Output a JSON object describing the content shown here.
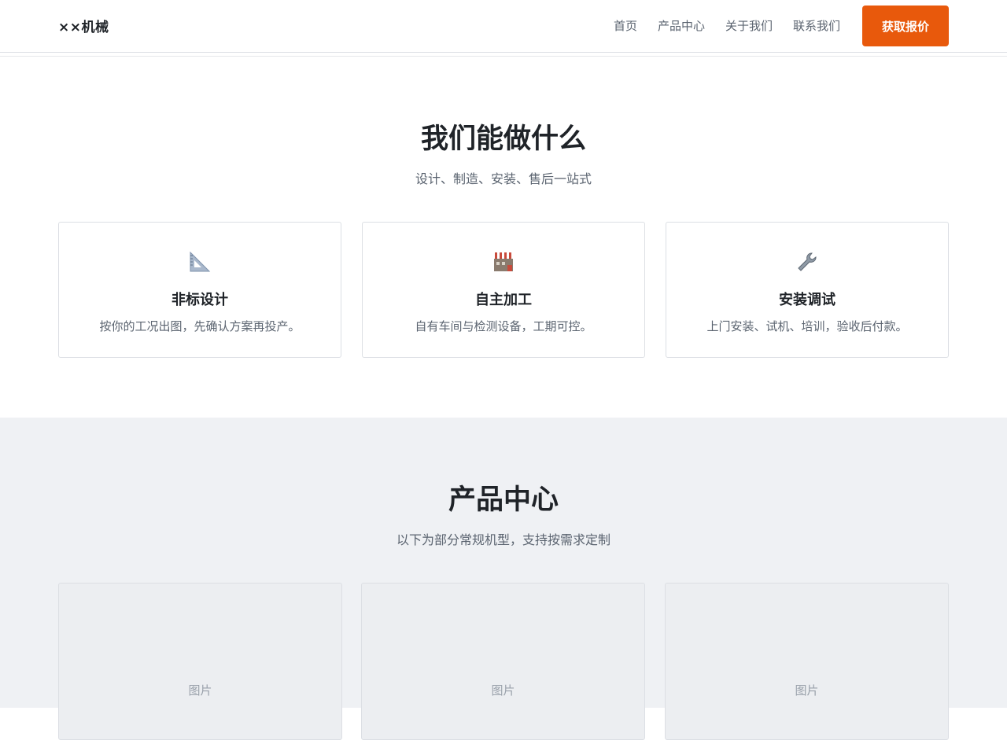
{
  "header": {
    "logo": "××机械",
    "nav": [
      "首页",
      "产品中心",
      "关于我们",
      "联系我们"
    ],
    "cta_label": "获取报价",
    "accent_color": "#e8590c"
  },
  "services": {
    "title": "我们能做什么",
    "subtitle": "设计、制造、安装、售后一站式",
    "cards": [
      {
        "icon": "triangle-ruler-icon",
        "title": "非标设计",
        "desc": "按你的工况出图，先确认方案再投产。"
      },
      {
        "icon": "factory-icon",
        "title": "自主加工",
        "desc": "自有车间与检测设备，工期可控。"
      },
      {
        "icon": "wrench-icon",
        "title": "安装调试",
        "desc": "上门安装、试机、培训，验收后付款。"
      }
    ]
  },
  "products": {
    "title": "产品中心",
    "subtitle": "以下为部分常规机型，支持按需求定制",
    "items": [
      {
        "image_label": "图片"
      },
      {
        "image_label": "图片"
      },
      {
        "image_label": "图片"
      }
    ]
  }
}
